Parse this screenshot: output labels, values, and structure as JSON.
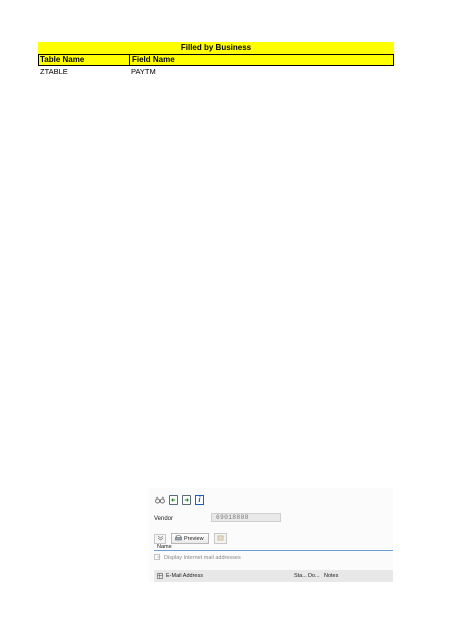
{
  "sheet": {
    "banner": "Filled by Business",
    "headers": [
      "Table Name",
      "Field Name"
    ],
    "rows": [
      [
        "ZTABLE",
        "PAYTM"
      ]
    ]
  },
  "sap": {
    "toolbar_icons": [
      "glasses-icon",
      "doc-back-icon",
      "doc-forward-icon",
      "info-icon"
    ],
    "vendor_label": "Vendor",
    "vendor_value": "69018808",
    "preview_label": "Preview",
    "name_label": "Name",
    "display_text": "Display Internet mail addresses",
    "table_headers": {
      "email": "E-Mail Address",
      "sta": "Sta...",
      "do": "Do...",
      "notes": "Notes"
    }
  }
}
